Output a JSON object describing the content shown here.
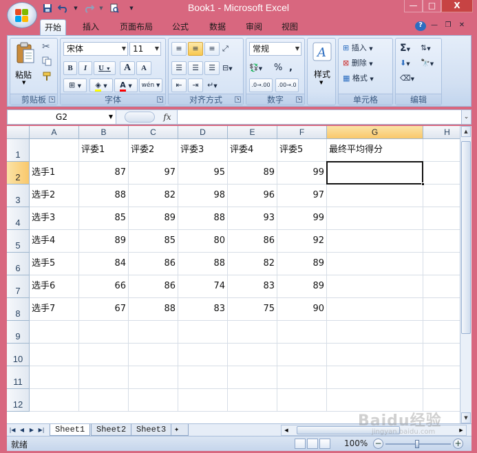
{
  "window": {
    "title": "Book1 - Microsoft Excel",
    "controls": [
      "—",
      "□",
      "X"
    ]
  },
  "qat": {
    "save_icon": "save-icon",
    "undo_icon": "undo-icon",
    "redo_icon": "redo-icon",
    "print_preview_icon": "print-preview-icon",
    "customize_icon": "chevron-down-icon"
  },
  "ribbon": {
    "tabs": [
      "开始",
      "插入",
      "页面布局",
      "公式",
      "数据",
      "审阅",
      "视图"
    ],
    "active_tab": "开始",
    "groups": {
      "clipboard": {
        "label": "剪贴板",
        "paste": "粘贴"
      },
      "font": {
        "label": "字体",
        "font_name": "宋体",
        "font_size": "11",
        "bold": "B",
        "italic": "I",
        "underline": "U",
        "grow": "A",
        "shrink": "A",
        "fill_color": "#ffff00",
        "font_color": "#ff0000",
        "phonetic": "wén"
      },
      "alignment": {
        "label": "对齐方式"
      },
      "number": {
        "label": "数字",
        "format": "常规",
        "percent": "%",
        "comma": ",",
        "inc_decimal": ".0→.00",
        "dec_decimal": ".00→.0"
      },
      "styles": {
        "label": "样式"
      },
      "cells": {
        "label": "单元格",
        "insert": "插入",
        "delete": "删除",
        "format": "格式"
      },
      "editing": {
        "label": "编辑",
        "sum": "Σ"
      }
    }
  },
  "formula_bar": {
    "name_box": "G2",
    "fx": "fx",
    "formula": ""
  },
  "grid": {
    "columns": [
      "A",
      "B",
      "C",
      "D",
      "E",
      "F",
      "G",
      "H"
    ],
    "selected_column": "G",
    "rows": [
      "1",
      "2",
      "3",
      "4",
      "5",
      "6",
      "7",
      "8",
      "9",
      "10",
      "11",
      "12"
    ],
    "selected_row": "2",
    "header_row": [
      "",
      "评委1",
      "评委2",
      "评委3",
      "评委4",
      "评委5",
      "最终平均得分",
      ""
    ],
    "data": [
      [
        "选手1",
        87,
        97,
        95,
        89,
        99
      ],
      [
        "选手2",
        88,
        82,
        98,
        96,
        97
      ],
      [
        "选手3",
        85,
        89,
        88,
        93,
        99
      ],
      [
        "选手4",
        89,
        85,
        80,
        86,
        92
      ],
      [
        "选手5",
        84,
        86,
        88,
        82,
        89
      ],
      [
        "选手6",
        66,
        86,
        74,
        83,
        89
      ],
      [
        "选手7",
        67,
        88,
        83,
        75,
        90
      ]
    ]
  },
  "sheets": {
    "tabs": [
      "Sheet1",
      "Sheet2",
      "Sheet3"
    ],
    "active": "Sheet1"
  },
  "status": {
    "text": "就绪",
    "zoom": "100%",
    "zoom_minus": "−",
    "zoom_plus": "+"
  },
  "watermark": {
    "text": "Baidu经验",
    "sub": "jingyan.baidu.com"
  },
  "colors": {
    "title_bar": "#d8677f",
    "ribbon": "#d1dff2",
    "header_selected": "#f9c86b",
    "grid_line": "#d6dde6"
  }
}
